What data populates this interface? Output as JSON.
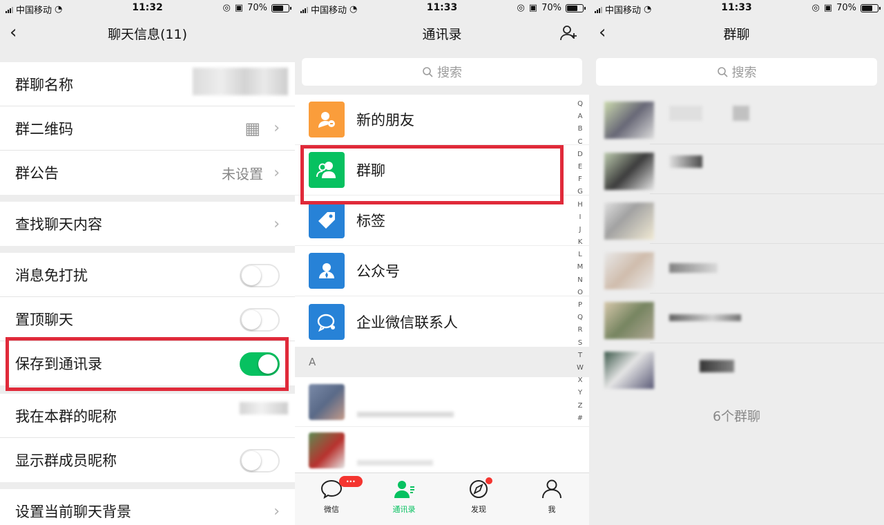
{
  "status": {
    "carrier": "中国移动",
    "time_left": "11:32",
    "time_mid": "11:33",
    "time_right": "11:33",
    "battery": "70%",
    "battery_level": 0.7
  },
  "p1": {
    "title": "聊天信息(11)",
    "rows": {
      "group_name": "群聊名称",
      "qrcode": "群二维码",
      "notice": "群公告",
      "notice_value": "未设置",
      "search_chat": "查找聊天内容",
      "mute": "消息免打扰",
      "pin": "置顶聊天",
      "save_contacts": "保存到通讯录",
      "my_nickname": "我在本群的昵称",
      "show_nicknames": "显示群成员昵称",
      "set_background": "设置当前聊天背景"
    },
    "toggles": {
      "mute": false,
      "pin": false,
      "save_contacts": true,
      "show_nicknames": false
    }
  },
  "p2": {
    "title": "通讯录",
    "search_placeholder": "搜索",
    "items": [
      {
        "label": "新的朋友",
        "color": "#fa9d3b",
        "icon": "new-friend-icon"
      },
      {
        "label": "群聊",
        "color": "#07c160",
        "icon": "group-chat-icon"
      },
      {
        "label": "标签",
        "color": "#2782d7",
        "icon": "tag-icon"
      },
      {
        "label": "公众号",
        "color": "#2782d7",
        "icon": "official-account-icon"
      },
      {
        "label": "企业微信联系人",
        "color": "#2782d7",
        "icon": "wecom-contact-icon"
      }
    ],
    "section_letter": "A",
    "index": [
      "Q",
      "A",
      "B",
      "C",
      "D",
      "E",
      "F",
      "G",
      "H",
      "I",
      "J",
      "K",
      "L",
      "M",
      "N",
      "O",
      "P",
      "Q",
      "R",
      "S",
      "T",
      "W",
      "X",
      "Y",
      "Z",
      "#"
    ],
    "tabs": [
      {
        "label": "微信",
        "icon": "chat-bubble-icon"
      },
      {
        "label": "通讯录",
        "icon": "contacts-icon"
      },
      {
        "label": "发现",
        "icon": "compass-icon"
      },
      {
        "label": "我",
        "icon": "person-icon"
      }
    ],
    "badge": "···",
    "accent": "#07c160",
    "highlight": "#e02a3a"
  },
  "p3": {
    "title": "群聊",
    "search_placeholder": "搜索",
    "count_text": "6个群聊"
  }
}
